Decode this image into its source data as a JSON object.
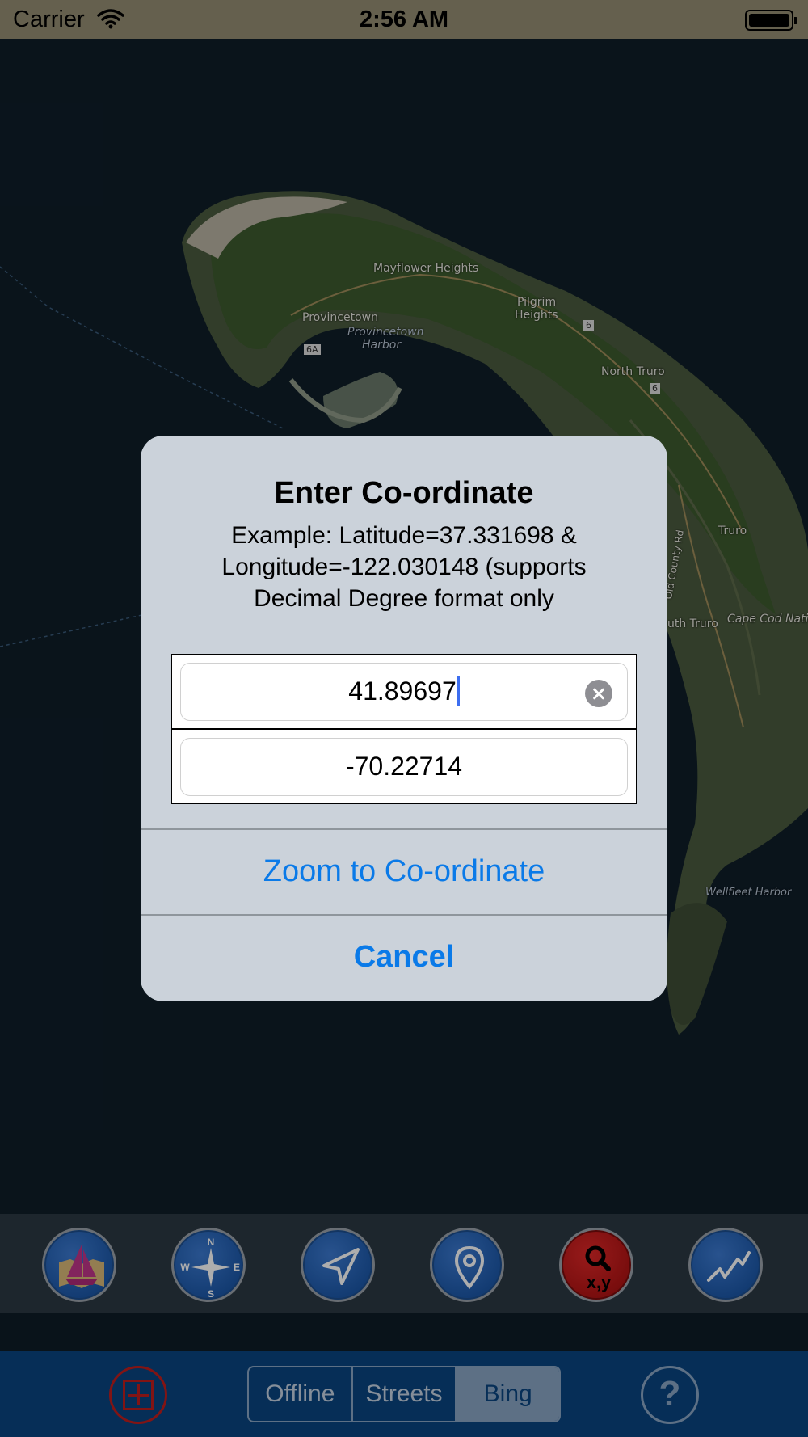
{
  "status_bar": {
    "carrier": "Carrier",
    "time": "2:56 AM",
    "wifi_icon": "wifi-icon",
    "battery_icon": "battery-icon"
  },
  "map": {
    "labels": {
      "mayflower_heights": "Mayflower Heights",
      "provincetown": "Provincetown",
      "provincetown_harbor_1": "Provincetown",
      "provincetown_harbor_2": "Harbor",
      "pilgrim_heights_1": "Pilgrim",
      "pilgrim_heights_2": "Heights",
      "north_truro": "North Truro",
      "truro": "Truro",
      "old_county_rd": "Old County Rd",
      "south_truro": "uth Truro",
      "cape_cod_national": "Cape Cod Nation",
      "wellfleet_harbor": "Wellfleet Harbor",
      "route_6a": "6A",
      "route_6": "6"
    }
  },
  "alert": {
    "title": "Enter Co-ordinate",
    "message": "Example: Latitude=37.331698 & Longitude=-122.030148 (supports Decimal Degree format only",
    "latitude_value": "41.89697",
    "longitude_value": "-70.22714",
    "zoom_button": "Zoom to Co-ordinate",
    "cancel_button": "Cancel"
  },
  "toolbar": {
    "tools": [
      {
        "icon": "sailboat-map-icon"
      },
      {
        "icon": "compass-rose-icon",
        "letters": [
          "N",
          "S",
          "E",
          "W"
        ]
      },
      {
        "icon": "navigation-arrow-icon"
      },
      {
        "icon": "location-pin-icon"
      },
      {
        "icon": "search-coordinate-icon",
        "label": "x,y"
      },
      {
        "icon": "route-line-icon"
      }
    ]
  },
  "bottom_bar": {
    "segments": [
      "Offline",
      "Streets",
      "Bing"
    ],
    "selected_segment": "Bing",
    "help_label": "?"
  },
  "colors": {
    "accent_blue": "#0a7ae8",
    "alert_background": "#cbd2da",
    "toolbar_blue": "#0a4580",
    "search_red": "#c01e1e"
  }
}
